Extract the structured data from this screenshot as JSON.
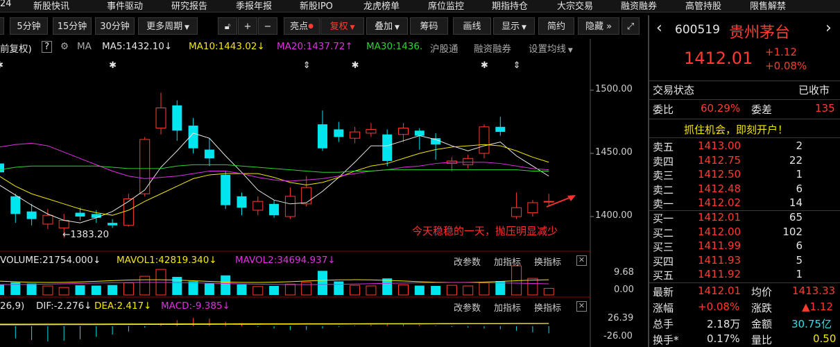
{
  "menu": [
    "24",
    "新股快讯",
    "事件驱动",
    "研究报告",
    "季报年报",
    "新股IPO",
    "龙虎榜单",
    "席位监控",
    "期指持仓",
    "大宗交易",
    "融资融券",
    "高管持股",
    "限售解禁"
  ],
  "toolbar": {
    "period_5": "5分钟",
    "period_15": "15分钟",
    "period_30": "30分钟",
    "more_periods": "更多周期",
    "highlight": "亮点",
    "restore": "复权",
    "overlay": "叠加",
    "chips": "筹码",
    "draw_line": "画线",
    "display": "显示",
    "simple": "简约",
    "hide": "隐藏"
  },
  "infoline": {
    "adjust": "前复权)",
    "help": "?",
    "ma_label": "MA",
    "ma5": "MA5:1432.10",
    "ma10": "MA10:1443.02",
    "ma20": "MA20:1437.72",
    "ma30": "MA30:1436.",
    "hk_connect": "沪股通",
    "margin": "融资融券",
    "set_ma": "设置均线"
  },
  "price_axis": {
    "p1500": "1500.00",
    "p1450": "1450.00",
    "p1400": "1400.00"
  },
  "low_label": "1383.20",
  "annotation": "今天稳稳的一天，抛压明显减少",
  "volume_legend": {
    "volume": "VOLUME:21754.000",
    "mavol1": "MAVOL1:42819.340",
    "mavol2": "MAVOL2:34694.937"
  },
  "volume_axis": {
    "top": "9.68",
    "bottom": "0.00"
  },
  "macd_legend": {
    "params": "26,9)",
    "dif": "DIF:-2.276",
    "dea": "DEA:2.417",
    "macd": "MACD:-9.385"
  },
  "macd_axis": {
    "top": "26.39",
    "bottom": "-26.00"
  },
  "sub_buttons": {
    "change_params": "改参数",
    "add_indicator": "加指标",
    "switch_indicator": "换指标"
  },
  "stock": {
    "code": "600519",
    "name": "贵州茅台",
    "price": "1412.01",
    "change": "+1.12",
    "change_pct": "+0.08%"
  },
  "status": {
    "label": "交易状态",
    "value": "已收市"
  },
  "weibi": {
    "label": "委比",
    "value": "60.29%",
    "diff_label": "委差",
    "diff_value": "135"
  },
  "promo": "抓住机会，即刻开户！",
  "asks": [
    {
      "label": "卖五",
      "price": "1413.00",
      "vol": "2"
    },
    {
      "label": "卖四",
      "price": "1412.75",
      "vol": "22"
    },
    {
      "label": "卖三",
      "price": "1412.50",
      "vol": "1"
    },
    {
      "label": "卖二",
      "price": "1412.48",
      "vol": "6"
    },
    {
      "label": "卖一",
      "price": "1412.02",
      "vol": "14"
    }
  ],
  "bids": [
    {
      "label": "买一",
      "price": "1412.01",
      "vol": "65"
    },
    {
      "label": "买二",
      "price": "1412.00",
      "vol": "102"
    },
    {
      "label": "买三",
      "price": "1411.99",
      "vol": "6"
    },
    {
      "label": "买四",
      "price": "1411.93",
      "vol": "5"
    },
    {
      "label": "买五",
      "price": "1411.92",
      "vol": "1"
    }
  ],
  "stats": {
    "latest_l": "最新",
    "latest_v": "1412.01",
    "avg_l": "均价",
    "avg_v": "1413.33",
    "chgpct_l": "涨幅",
    "chgpct_v": "+0.08%",
    "chg_l": "涨跌",
    "chg_v": "▲1.12",
    "total_l": "总手",
    "total_v": "2.18万",
    "amount_l": "金额",
    "amount_v": "30.75亿",
    "turnover_l": "换手*",
    "turnover_v": "0.17%",
    "ratio_l": "量比",
    "ratio_v": "0.50"
  },
  "colors": {
    "up": "#ff3b30",
    "down": "#00e5ee",
    "ma5": "#e8e8e8",
    "ma10": "#f5e700",
    "ma20": "#e030e0",
    "ma30": "#2bd62b"
  },
  "candles": [
    {
      "o": 1442,
      "c": 1435,
      "h": 1445,
      "l": 1428
    },
    {
      "o": 1416,
      "c": 1402,
      "h": 1418,
      "l": 1395
    },
    {
      "o": 1404,
      "c": 1398,
      "h": 1410,
      "l": 1393
    },
    {
      "o": 1394,
      "c": 1401,
      "h": 1406,
      "l": 1390
    },
    {
      "o": 1391,
      "c": 1397,
      "h": 1402,
      "l": 1383.2
    },
    {
      "o": 1403,
      "c": 1400,
      "h": 1407,
      "l": 1397
    },
    {
      "o": 1402,
      "c": 1399,
      "h": 1405,
      "l": 1395
    },
    {
      "o": 1395,
      "c": 1393,
      "h": 1398,
      "l": 1391
    },
    {
      "o": 1393,
      "c": 1414,
      "h": 1418,
      "l": 1392
    },
    {
      "o": 1418,
      "c": 1461,
      "h": 1463,
      "l": 1416
    },
    {
      "o": 1470,
      "c": 1486,
      "h": 1498,
      "l": 1465
    },
    {
      "o": 1488,
      "c": 1468,
      "h": 1492,
      "l": 1460
    },
    {
      "o": 1472,
      "c": 1454,
      "h": 1478,
      "l": 1450
    },
    {
      "o": 1453,
      "c": 1446,
      "h": 1462,
      "l": 1440
    },
    {
      "o": 1433,
      "c": 1409,
      "h": 1436,
      "l": 1406
    },
    {
      "o": 1416,
      "c": 1407,
      "h": 1419,
      "l": 1401
    },
    {
      "o": 1405,
      "c": 1412,
      "h": 1416,
      "l": 1401
    },
    {
      "o": 1410,
      "c": 1401,
      "h": 1413,
      "l": 1399
    },
    {
      "o": 1400,
      "c": 1416,
      "h": 1423,
      "l": 1398
    },
    {
      "o": 1410,
      "c": 1423,
      "h": 1432,
      "l": 1408
    },
    {
      "o": 1473,
      "c": 1454,
      "h": 1484,
      "l": 1452
    },
    {
      "o": 1469,
      "c": 1463,
      "h": 1475,
      "l": 1459
    },
    {
      "o": 1462,
      "c": 1467,
      "h": 1471,
      "l": 1458
    },
    {
      "o": 1466,
      "c": 1469,
      "h": 1474,
      "l": 1463
    },
    {
      "o": 1465,
      "c": 1444,
      "h": 1469,
      "l": 1440
    },
    {
      "o": 1465,
      "c": 1470,
      "h": 1474,
      "l": 1459
    },
    {
      "o": 1468,
      "c": 1464,
      "h": 1470,
      "l": 1453
    },
    {
      "o": 1462,
      "c": 1457,
      "h": 1466,
      "l": 1445
    },
    {
      "o": 1442,
      "c": 1444,
      "h": 1447,
      "l": 1436
    },
    {
      "o": 1441,
      "c": 1446,
      "h": 1449,
      "l": 1438
    },
    {
      "o": 1450,
      "c": 1471,
      "h": 1473,
      "l": 1446
    },
    {
      "o": 1471,
      "c": 1467,
      "h": 1479,
      "l": 1464
    },
    {
      "o": 1400,
      "c": 1407,
      "h": 1419,
      "l": 1398
    },
    {
      "o": 1403,
      "c": 1411,
      "h": 1413,
      "l": 1400
    },
    {
      "o": 1412,
      "c": 1412,
      "h": 1418,
      "l": 1409
    }
  ],
  "ma_lines": {
    "ma5": [
      1425,
      1417,
      1409,
      1402,
      1397,
      1395,
      1399,
      1404,
      1412,
      1421,
      1439,
      1452,
      1466,
      1462,
      1448,
      1435,
      1421,
      1413,
      1410,
      1411,
      1420,
      1431,
      1443,
      1456,
      1456,
      1460,
      1464,
      1461,
      1456,
      1452,
      1456,
      1459,
      1448,
      1440,
      1432
    ],
    "ma10": [
      1432,
      1424,
      1418,
      1414,
      1410,
      1406,
      1403,
      1401,
      1405,
      1412,
      1418,
      1424,
      1430,
      1433,
      1434,
      1434,
      1434,
      1431,
      1427,
      1425,
      1427,
      1431,
      1436,
      1440,
      1442,
      1446,
      1450,
      1453,
      1455,
      1456,
      1457,
      1456,
      1452,
      1447,
      1443
    ],
    "ma20": [
      1455,
      1457,
      1458,
      1456,
      1451,
      1446,
      1441,
      1436,
      1432,
      1430,
      1431,
      1432,
      1434,
      1436,
      1436,
      1434,
      1431,
      1429,
      1428,
      1429,
      1430,
      1432,
      1434,
      1436,
      1437,
      1439,
      1440,
      1442,
      1443,
      1443,
      1443,
      1442,
      1440,
      1438,
      1437
    ],
    "ma30": [
      1437,
      1439,
      1440,
      1440,
      1440,
      1440,
      1440,
      1439,
      1438,
      1438,
      1438,
      1440,
      1441,
      1441,
      1441,
      1440,
      1439,
      1438,
      1437,
      1436,
      1435,
      1435,
      1436,
      1436,
      1437,
      1437,
      1437,
      1437,
      1437,
      1437,
      1437,
      1437,
      1437,
      1436,
      1436
    ]
  },
  "volumes": [
    3.5,
    4.2,
    3.8,
    3.0,
    2.5,
    3.2,
    3.1,
    3.3,
    4.0,
    6.2,
    8.5,
    6.0,
    4.5,
    3.8,
    6.5,
    3.5,
    2.8,
    3.0,
    3.6,
    4.2,
    8.0,
    4.5,
    3.2,
    3.0,
    5.5,
    3.4,
    3.1,
    3.0,
    3.2,
    3.0,
    4.0,
    4.6,
    9.68,
    5.5,
    2.18
  ],
  "macd_bars": [
    -14,
    -16,
    -18,
    -20,
    -19,
    -17,
    -14,
    -11,
    -7,
    -2,
    4,
    8,
    11,
    10,
    6,
    2,
    -1,
    -3,
    -5,
    -5,
    -3,
    -1,
    1,
    2,
    3,
    3,
    2,
    1,
    -1,
    -2,
    -3,
    -4,
    -6,
    -8,
    -9.385
  ]
}
